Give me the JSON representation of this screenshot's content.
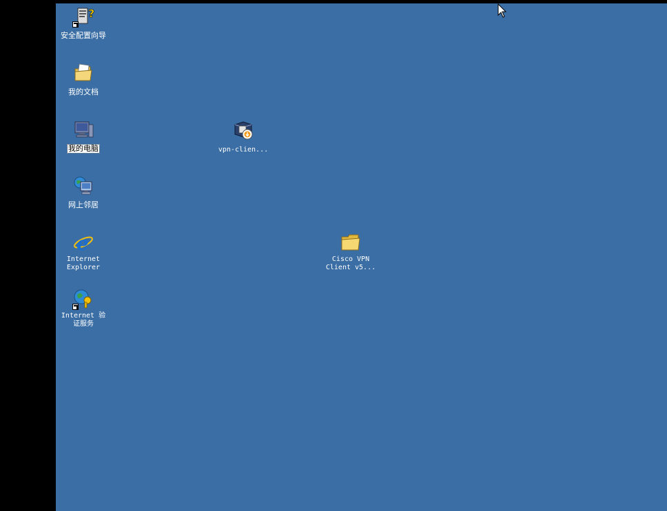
{
  "desktop": {
    "background_color": "#3a6ea5",
    "icons": [
      {
        "label": "安全配置向导",
        "icon": "security-wizard-icon",
        "shortcut": true
      },
      {
        "label": "我的文档",
        "icon": "documents-folder-icon",
        "shortcut": false
      },
      {
        "label": "我的电脑",
        "icon": "computer-icon",
        "shortcut": false,
        "selected": true
      },
      {
        "label": "网上邻居",
        "icon": "network-icon",
        "shortcut": false
      },
      {
        "label": "Internet\nExplorer",
        "icon": "internet-explorer-icon",
        "shortcut": false
      },
      {
        "label": "Internet 验\n证服务",
        "icon": "certificate-services-icon",
        "shortcut": true
      },
      {
        "label": "vpn-clien...",
        "icon": "installer-package-icon",
        "shortcut": false
      },
      {
        "label": "Cisco VPN\nClient v5...",
        "icon": "folder-icon",
        "shortcut": false
      }
    ]
  },
  "cursor": {
    "icon": "mouse-pointer-icon"
  }
}
